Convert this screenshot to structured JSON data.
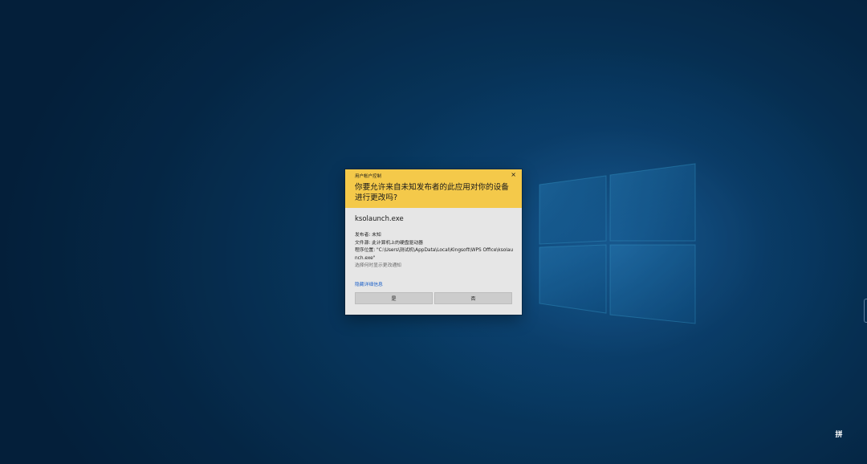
{
  "colors": {
    "dialog_header": "#f4c94a",
    "dialog_body": "#e6e6e6",
    "link": "#2063c9",
    "desktop_bg": "#083a62"
  },
  "dialog": {
    "title": "用户帐户控制",
    "close_glyph": "×",
    "question": "你要允许来自未知发布者的此应用对你的设备进行更改吗?",
    "app_name": "ksolaunch.exe",
    "publisher": "发布者: 未知",
    "file_origin": "文件源: 此计算机上的硬盘驱动器",
    "program_location": "程序位置: \"C:\\Users\\测试机\\AppData\\Local\\Kingsoft\\WPS Office\\ksolaunch.exe\"",
    "notify_setting": "选择何时显示更改通知",
    "details_link": "隐藏详细信息",
    "yes_label": "是",
    "no_label": "否"
  },
  "taskbar": {
    "ime_indicator": "拼"
  },
  "icons": [
    "close-icon",
    "windows-logo",
    "ime-icon"
  ]
}
